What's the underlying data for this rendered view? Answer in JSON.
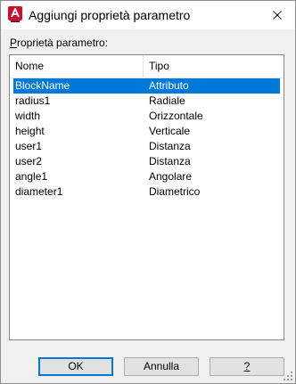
{
  "window": {
    "title": "Aggiungi proprietà parametro",
    "app_icon": "autocad-a-icon",
    "accent_color": "#c8102e",
    "close_icon": "close-icon"
  },
  "group": {
    "label": "Proprietà parametro:"
  },
  "table": {
    "columns": [
      "Nome",
      "Tipo"
    ],
    "selected_index": 0,
    "selection_color": "#0078d7",
    "rows": [
      {
        "name": "BlockName",
        "type": "Attributo"
      },
      {
        "name": "radius1",
        "type": "Radiale"
      },
      {
        "name": "width",
        "type": "Orizzontale"
      },
      {
        "name": "height",
        "type": "Verticale"
      },
      {
        "name": "user1",
        "type": "Distanza"
      },
      {
        "name": "user2",
        "type": "Distanza"
      },
      {
        "name": "angle1",
        "type": "Angolare"
      },
      {
        "name": "diameter1",
        "type": "Diametrico"
      }
    ]
  },
  "buttons": {
    "ok": "OK",
    "cancel": "Annulla",
    "help": "?"
  }
}
